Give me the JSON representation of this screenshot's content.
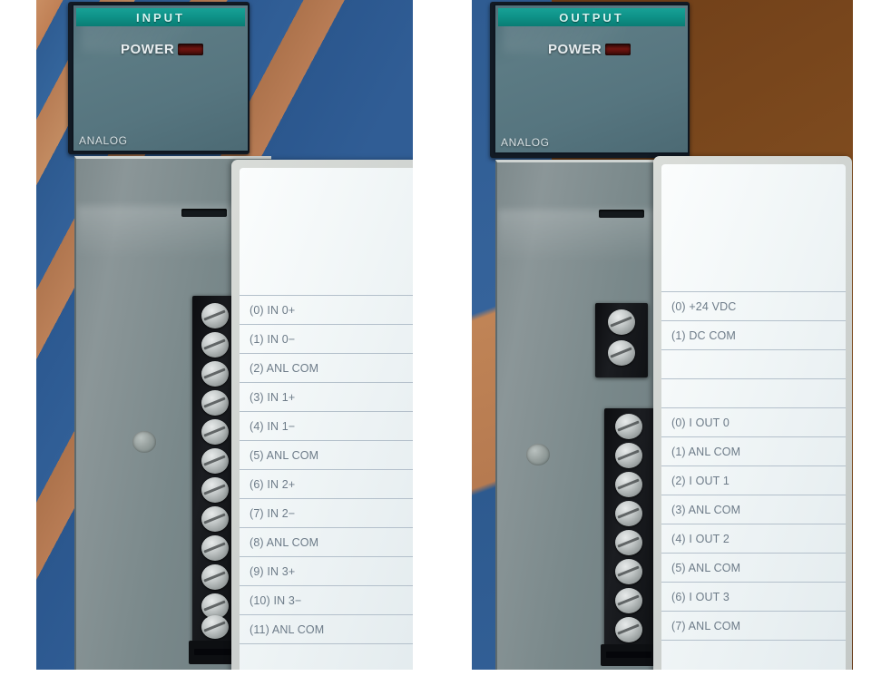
{
  "scene": {
    "description": "Two photographs of analog PLC I/O modules side by side",
    "accent_teal": "#0e9288",
    "led_color": "#6e1410",
    "body_gray": "#7e8a8c",
    "label_text_color": "#6d7b88"
  },
  "modules": [
    {
      "id": "input-module",
      "header_label": "INPUT",
      "power_label": "POWER",
      "power_led_state": "off",
      "family_label": "ANALOG",
      "terminal_blocks": [
        {
          "id": "input-terminal-block",
          "screw_count": 12
        }
      ],
      "label_card": {
        "rows": [
          {
            "text": "",
            "blank": true
          },
          {
            "text": "(0) IN 0+"
          },
          {
            "text": "(1) IN 0−"
          },
          {
            "text": "(2) ANL COM"
          },
          {
            "text": "(3) IN 1+"
          },
          {
            "text": "(4) IN 1−"
          },
          {
            "text": "(5) ANL COM"
          },
          {
            "text": "(6) IN 2+"
          },
          {
            "text": "(7) IN 2−"
          },
          {
            "text": "(8) ANL COM"
          },
          {
            "text": "(9) IN 3+"
          },
          {
            "text": "(10) IN 3−"
          },
          {
            "text": "(11) ANL COM"
          },
          {
            "text": "",
            "blank": true
          }
        ]
      }
    },
    {
      "id": "output-module",
      "header_label": "OUTPUT",
      "power_label": "POWER",
      "power_led_state": "off",
      "family_label": "ANALOG",
      "terminal_blocks": [
        {
          "id": "output-power-terminal-block",
          "screw_count": 2
        },
        {
          "id": "output-signal-terminal-block",
          "screw_count": 8
        }
      ],
      "label_card": {
        "rows": [
          {
            "text": "",
            "blank": true
          },
          {
            "text": "(0) +24 VDC"
          },
          {
            "text": "(1) DC COM"
          },
          {
            "text": "",
            "blank": true
          },
          {
            "text": "",
            "blank": true
          },
          {
            "text": "(0) I OUT 0"
          },
          {
            "text": "(1) ANL COM"
          },
          {
            "text": "(2) I OUT 1"
          },
          {
            "text": "(3) ANL COM"
          },
          {
            "text": "(4) I OUT 2"
          },
          {
            "text": "(5) ANL COM"
          },
          {
            "text": "(6) I OUT 3"
          },
          {
            "text": "(7) ANL COM"
          },
          {
            "text": "",
            "blank": true
          }
        ]
      }
    }
  ]
}
